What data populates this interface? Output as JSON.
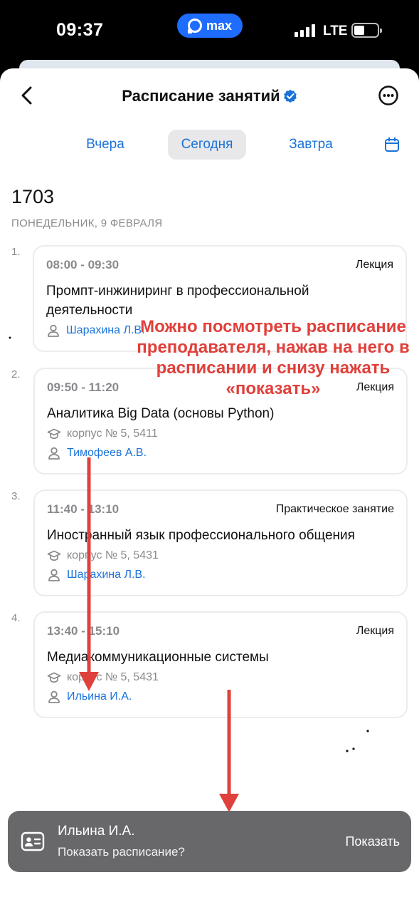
{
  "status_bar": {
    "time": "09:37",
    "app_badge": "max",
    "network": "LTE"
  },
  "header": {
    "title": "Расписание занятий"
  },
  "tabs": {
    "yesterday": "Вчера",
    "today": "Сегодня",
    "tomorrow": "Завтра",
    "active": "today"
  },
  "group": "1703",
  "date": "ПОНЕДЕЛЬНИК, 9 ФЕВРАЛЯ",
  "lessons": [
    {
      "num": "1.",
      "time": "08:00 - 09:30",
      "type": "Лекция",
      "subject": "Промпт-инжиниринг в профессиональной деятельности",
      "room": "",
      "teacher": "Шарахина Л.В."
    },
    {
      "num": "2.",
      "time": "09:50 - 11:20",
      "type": "Лекция",
      "subject": "Аналитика Big Data (основы Python)",
      "room": "корпус № 5, 5411",
      "teacher": "Тимофеев А.В."
    },
    {
      "num": "3.",
      "time": "11:40 - 13:10",
      "type": "Практическое занятие",
      "subject": "Иностранный язык профессионального общения",
      "room": "корпус № 5, 5431",
      "teacher": "Шарахина Л.В."
    },
    {
      "num": "4.",
      "time": "13:40 - 15:10",
      "type": "Лекция",
      "subject": "Медиакоммуникационные системы",
      "room": "корпус № 5, 5431",
      "teacher": "Ильина И.А."
    }
  ],
  "snackbar": {
    "name": "Ильина И.А.",
    "question": "Показать расписание?",
    "action": "Показать"
  },
  "annotation": {
    "text": "Можно посмотреть расписание преподавателя, нажав на него в расписании и снизу нажать «показать»",
    "color": "#e0403b"
  },
  "colors": {
    "accent": "#1a73d9",
    "muted": "#8a8a8e",
    "snackbar_bg": "#68686b",
    "tab_active_bg": "#e8e8ea"
  }
}
